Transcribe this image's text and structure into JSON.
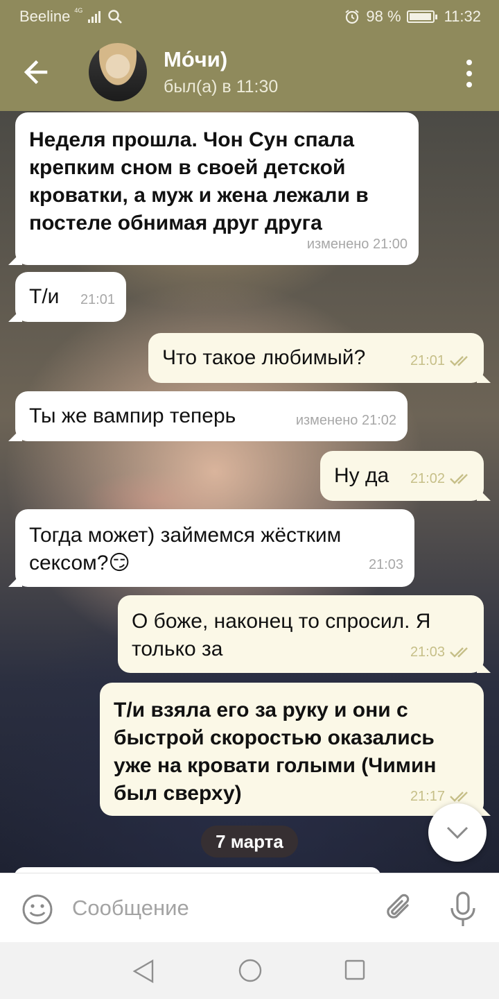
{
  "status_bar": {
    "carrier": "Beeline",
    "network": "4G",
    "battery_percent": "98 %",
    "battery_level": 0.98,
    "time": "11:32"
  },
  "header": {
    "contact_name": "Мо́чи)",
    "last_seen": "был(а) в 11:30"
  },
  "messages": [
    {
      "direction": "incoming",
      "text": "Неделя прошла. Чон Сун спала крепким сном в своей детской кроватки, а муж и жена лежали в постеле обнимая друг друга",
      "time": "изменено 21:00",
      "bold": true
    },
    {
      "direction": "incoming",
      "text": "Т/и",
      "time": "21:01"
    },
    {
      "direction": "outgoing",
      "text": "Что такое любимый?",
      "time": "21:01",
      "read": true
    },
    {
      "direction": "incoming",
      "text": "Ты же вампир теперь",
      "time": "изменено 21:02"
    },
    {
      "direction": "outgoing",
      "text": "Ну да",
      "time": "21:02",
      "read": true
    },
    {
      "direction": "incoming",
      "text": "Тогда может) займемся жёстким сексом?😏",
      "time": "21:03"
    },
    {
      "direction": "outgoing",
      "text": "О боже, наконец то спросил. Я только за",
      "time": "21:03",
      "read": true
    },
    {
      "direction": "outgoing",
      "text": "Т/и взяла его за руку и они с быстрой скоростью оказались уже на кровати голыми (Чимин был сверху)",
      "time": "21:17",
      "read": true,
      "bold": true
    }
  ],
  "date_separator": "7 марта",
  "input": {
    "placeholder": "Сообщение"
  },
  "colors": {
    "header": "#8f8a5c",
    "incoming_bubble": "#ffffff",
    "outgoing_bubble": "#fbf8e7",
    "read_check": "#c6bf88"
  },
  "icons": [
    "back-arrow-icon",
    "more-vert-icon",
    "emoji-icon",
    "attach-icon",
    "mic-icon",
    "chevron-down-icon",
    "nav-back-icon",
    "nav-home-icon",
    "nav-recent-icon"
  ]
}
